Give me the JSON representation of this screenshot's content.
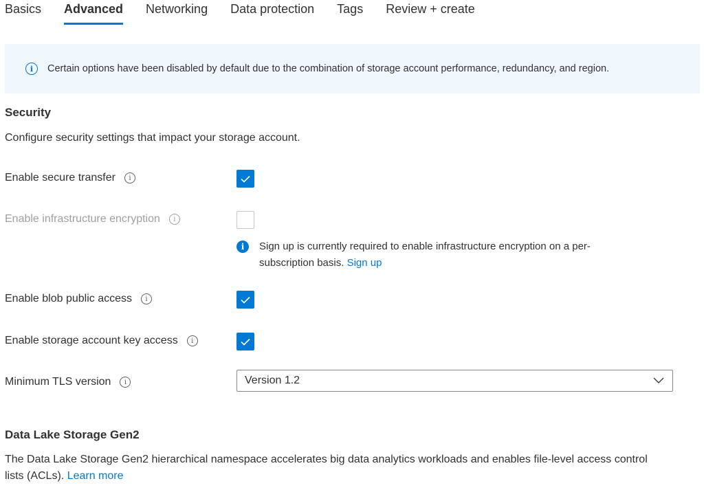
{
  "tabs": [
    {
      "label": "Basics",
      "active": false
    },
    {
      "label": "Advanced",
      "active": true
    },
    {
      "label": "Networking",
      "active": false
    },
    {
      "label": "Data protection",
      "active": false
    },
    {
      "label": "Tags",
      "active": false
    },
    {
      "label": "Review + create",
      "active": false
    }
  ],
  "info_banner": {
    "icon": "info-icon",
    "text": "Certain options have been disabled by default due to the combination of storage account performance, redundancy, and region."
  },
  "security": {
    "title": "Security",
    "description": "Configure security settings that impact your storage account.",
    "secure_transfer": {
      "label": "Enable secure transfer",
      "checked": true
    },
    "infra_encryption": {
      "label": "Enable infrastructure encryption",
      "checked": false,
      "disabled": true,
      "notice_text": "Sign up is currently required to enable infrastructure encryption on a per-subscription basis.",
      "notice_link": "Sign up"
    },
    "blob_public_access": {
      "label": "Enable blob public access",
      "checked": true
    },
    "key_access": {
      "label": "Enable storage account key access",
      "checked": true
    },
    "tls": {
      "label": "Minimum TLS version",
      "value": "Version 1.2"
    }
  },
  "data_lake": {
    "title": "Data Lake Storage Gen2",
    "description": "The Data Lake Storage Gen2 hierarchical namespace accelerates big data analytics workloads and enables file-level access control lists (ACLs).",
    "link": "Learn more"
  },
  "colors": {
    "accent": "#0078d4",
    "banner_bg": "#eff6fc",
    "disabled_text": "#a19f9d"
  }
}
